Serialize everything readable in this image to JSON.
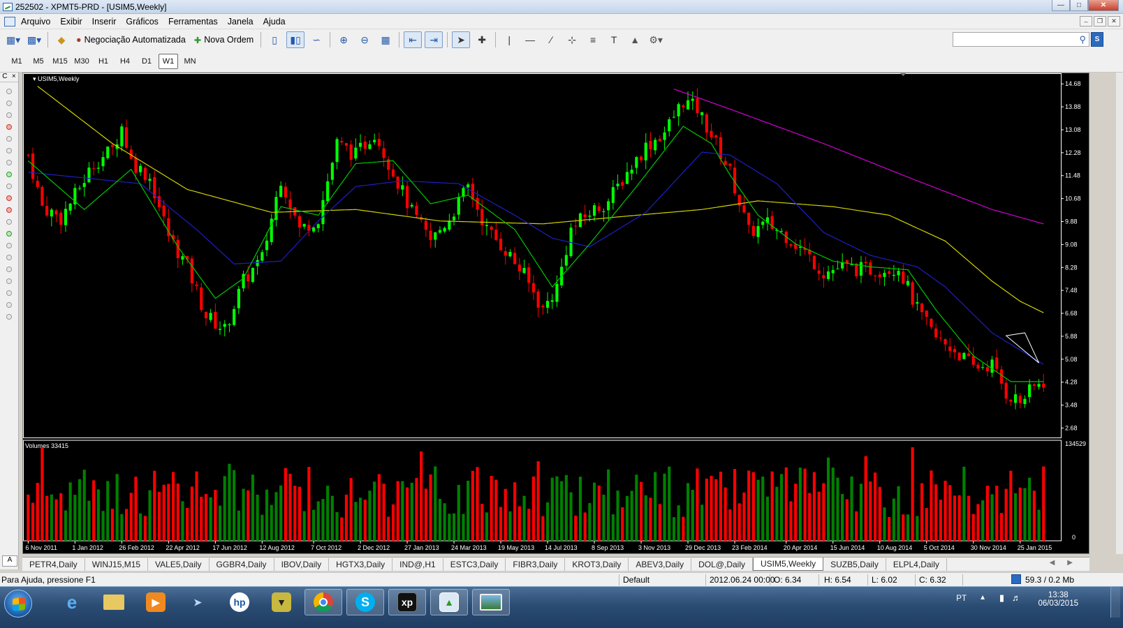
{
  "window": {
    "title": "252502 - XPMT5-PRD - [USIM5,Weekly]"
  },
  "menu": [
    "Arquivo",
    "Exibir",
    "Inserir",
    "Gráficos",
    "Ferramentas",
    "Janela",
    "Ajuda"
  ],
  "toolbar": {
    "auto_trading_label": "Negociação Automatizada",
    "new_order_label": "Nova Ordem"
  },
  "timeframes": [
    "M1",
    "M5",
    "M15",
    "M30",
    "H1",
    "H4",
    "D1",
    "W1",
    "MN"
  ],
  "active_timeframe": "W1",
  "left_panel": {
    "header_c": "C",
    "header_x": "×",
    "tab_label": "A"
  },
  "chart_data": {
    "type": "candlestick",
    "title": "USIM5,Weekly",
    "volume_label": "Volumes 33415",
    "volume_axis_max": "134529",
    "volume_axis_min": "0",
    "price_ticks": [
      "14.68",
      "13.88",
      "13.08",
      "12.28",
      "11.48",
      "10.68",
      "9.88",
      "9.08",
      "8.28",
      "7.48",
      "6.68",
      "5.88",
      "5.08",
      "4.28",
      "3.48",
      "2.68"
    ],
    "ylim": [
      2.35,
      15.05
    ],
    "x_labels": [
      "6 Nov 2011",
      "1 Jan 2012",
      "26 Feb 2012",
      "22 Apr 2012",
      "17 Jun 2012",
      "12 Aug 2012",
      "7 Oct 2012",
      "2 Dec 2012",
      "27 Jan 2013",
      "24 Mar 2013",
      "19 May 2013",
      "14 Jul 2013",
      "8 Sep 2013",
      "3 Nov 2013",
      "29 Dec 2013",
      "23 Feb 2014",
      "20 Apr 2014",
      "15 Jun 2014",
      "10 Aug 2014",
      "5 Oct 2014",
      "30 Nov 2014",
      "25 Jan 2015"
    ],
    "close_anchors": [
      [
        0,
        12.2
      ],
      [
        3,
        10.4
      ],
      [
        7,
        10.0
      ],
      [
        10,
        10.8
      ],
      [
        14,
        11.9
      ],
      [
        18,
        12.4
      ],
      [
        20,
        13.2
      ],
      [
        22,
        12.0
      ],
      [
        26,
        11.4
      ],
      [
        30,
        9.4
      ],
      [
        34,
        8.3
      ],
      [
        38,
        6.6
      ],
      [
        42,
        6.1
      ],
      [
        46,
        7.8
      ],
      [
        50,
        8.6
      ],
      [
        54,
        11.4
      ],
      [
        58,
        9.6
      ],
      [
        62,
        10.0
      ],
      [
        66,
        12.6
      ],
      [
        70,
        12.2
      ],
      [
        74,
        13.0
      ],
      [
        78,
        11.6
      ],
      [
        82,
        10.2
      ],
      [
        86,
        9.2
      ],
      [
        90,
        10.0
      ],
      [
        94,
        11.1
      ],
      [
        98,
        9.6
      ],
      [
        102,
        8.9
      ],
      [
        106,
        8.0
      ],
      [
        110,
        6.8
      ],
      [
        113,
        7.6
      ],
      [
        116,
        9.6
      ],
      [
        120,
        10.2
      ],
      [
        124,
        10.6
      ],
      [
        128,
        11.6
      ],
      [
        132,
        12.5
      ],
      [
        136,
        13.0
      ],
      [
        140,
        14.1
      ],
      [
        143,
        13.8
      ],
      [
        146,
        12.9
      ],
      [
        150,
        11.6
      ],
      [
        154,
        9.5
      ],
      [
        158,
        9.8
      ],
      [
        162,
        9.4
      ],
      [
        166,
        8.8
      ],
      [
        170,
        8.1
      ],
      [
        174,
        8.3
      ],
      [
        178,
        8.2
      ],
      [
        182,
        8.2
      ],
      [
        186,
        8.3
      ],
      [
        190,
        6.8
      ],
      [
        194,
        5.8
      ],
      [
        198,
        5.4
      ],
      [
        202,
        4.8
      ],
      [
        206,
        4.9
      ],
      [
        209,
        3.9
      ],
      [
        212,
        3.6
      ],
      [
        215,
        4.1
      ],
      [
        217,
        4.3
      ]
    ],
    "ma_green": [
      [
        0,
        12.0
      ],
      [
        12,
        10.3
      ],
      [
        22,
        11.7
      ],
      [
        32,
        9.0
      ],
      [
        40,
        7.2
      ],
      [
        46,
        7.9
      ],
      [
        54,
        10.4
      ],
      [
        62,
        10.1
      ],
      [
        70,
        11.9
      ],
      [
        78,
        12.0
      ],
      [
        86,
        10.5
      ],
      [
        94,
        10.8
      ],
      [
        104,
        9.6
      ],
      [
        112,
        7.6
      ],
      [
        120,
        9.1
      ],
      [
        130,
        11.1
      ],
      [
        140,
        13.2
      ],
      [
        146,
        12.6
      ],
      [
        150,
        11.5
      ],
      [
        156,
        10.1
      ],
      [
        164,
        9.1
      ],
      [
        172,
        8.5
      ],
      [
        180,
        8.3
      ],
      [
        188,
        8.2
      ],
      [
        194,
        6.8
      ],
      [
        202,
        5.2
      ],
      [
        210,
        4.3
      ],
      [
        217,
        4.3
      ]
    ],
    "ma_blue": [
      [
        0,
        11.6
      ],
      [
        24,
        11.2
      ],
      [
        36,
        9.6
      ],
      [
        44,
        8.4
      ],
      [
        54,
        8.5
      ],
      [
        62,
        9.9
      ],
      [
        70,
        11.1
      ],
      [
        80,
        11.3
      ],
      [
        92,
        11.2
      ],
      [
        104,
        10.1
      ],
      [
        112,
        9.3
      ],
      [
        120,
        9.0
      ],
      [
        132,
        10.2
      ],
      [
        144,
        12.3
      ],
      [
        150,
        12.2
      ],
      [
        160,
        11.2
      ],
      [
        170,
        9.5
      ],
      [
        180,
        8.7
      ],
      [
        190,
        8.3
      ],
      [
        196,
        7.6
      ],
      [
        206,
        6.0
      ],
      [
        212,
        5.4
      ],
      [
        217,
        4.9
      ]
    ],
    "ma_yellow": [
      [
        2,
        14.6
      ],
      [
        18,
        12.6
      ],
      [
        34,
        11.0
      ],
      [
        52,
        10.2
      ],
      [
        70,
        10.3
      ],
      [
        88,
        9.9
      ],
      [
        110,
        9.8
      ],
      [
        130,
        10.1
      ],
      [
        144,
        10.3
      ],
      [
        156,
        10.6
      ],
      [
        172,
        10.4
      ],
      [
        184,
        10.1
      ],
      [
        196,
        9.2
      ],
      [
        206,
        7.8
      ],
      [
        212,
        7.1
      ],
      [
        217,
        6.7
      ]
    ],
    "ma_magenta": [
      [
        138,
        14.5
      ],
      [
        150,
        13.8
      ],
      [
        170,
        12.6
      ],
      [
        190,
        11.3
      ],
      [
        206,
        10.3
      ],
      [
        217,
        9.8
      ]
    ],
    "volume_max": 134529
  },
  "tabs": [
    "PETR4,Daily",
    "WINJ15,M15",
    "VALE5,Daily",
    "GGBR4,Daily",
    "IBOV,Daily",
    "HGTX3,Daily",
    "IND@,H1",
    "ESTC3,Daily",
    "FIBR3,Daily",
    "KROT3,Daily",
    "ABEV3,Daily",
    "DOL@,Daily",
    "USIM5,Weekly",
    "SUZB5,Daily",
    "ELPL4,Daily"
  ],
  "active_tab": "USIM5,Weekly",
  "status": {
    "help": "Para Ajuda, pressione F1",
    "profile": "Default",
    "datetime": "2012.06.24 00:00",
    "open": "O: 6.34",
    "high": "H: 6.54",
    "low": "L: 6.02",
    "close": "C: 6.32",
    "traffic": "59.3 / 0.2 Mb"
  },
  "taskbar": {
    "language": "PT",
    "time": "13:38",
    "date": "06/03/2015",
    "apps": [
      "internet-explorer-icon",
      "folder-icon",
      "media-player-icon",
      "network-icon",
      "hp-icon",
      "trading-icon",
      "chrome-icon",
      "skype-icon",
      "xp-icon",
      "metatrader-icon",
      "image-viewer-icon"
    ]
  },
  "colors": {
    "bull": "#00ff00",
    "bear": "#ff0000",
    "vol_up": "#008000",
    "vol_down": "#ff0000",
    "ma_green": "#00c800",
    "ma_blue": "#1e1ec8",
    "ma_yellow": "#d2d200",
    "ma_magenta": "#d200d2"
  }
}
